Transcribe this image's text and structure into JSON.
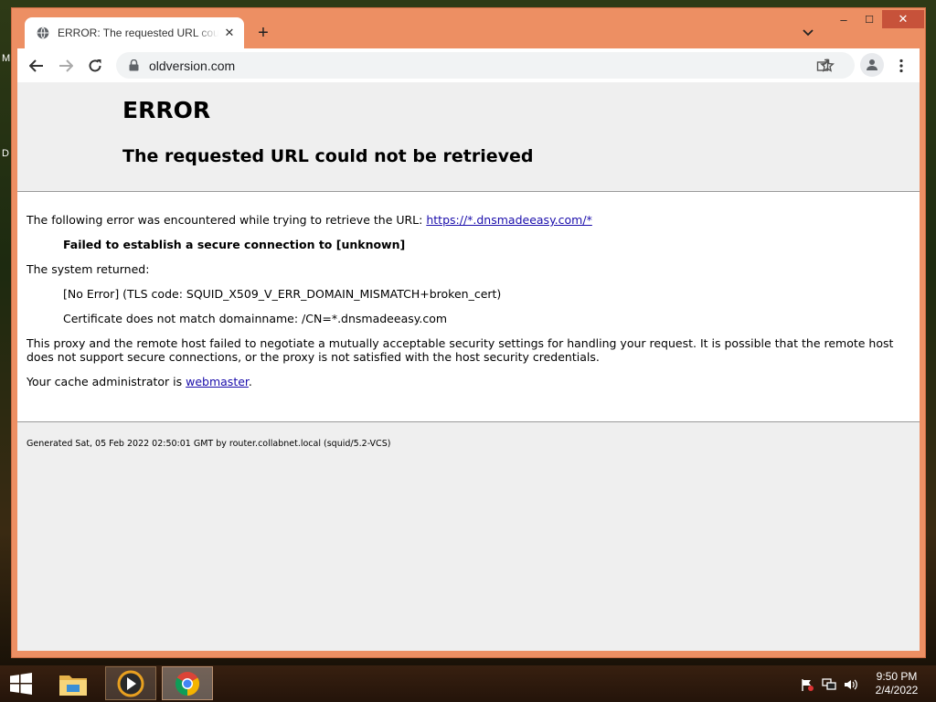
{
  "desktop": {
    "edge_letters": [
      "M",
      "D"
    ]
  },
  "browser": {
    "tab": {
      "title": "ERROR: The requested URL could not be retrieved",
      "icon": "globe-icon"
    },
    "new_tab_label": "+",
    "window_controls": {
      "minimize": "–",
      "maximize": "☐",
      "close": "✕"
    },
    "toolbar": {
      "back_icon": "arrow-left-icon",
      "forward_icon": "arrow-right-icon",
      "reload_icon": "reload-icon",
      "url": "oldversion.com"
    }
  },
  "page": {
    "h1": "ERROR",
    "h2": "The requested URL could not be retrieved",
    "intro_prefix": "The following error was encountered while trying to retrieve the URL: ",
    "intro_link": "https://*.dnsmadeeasy.com/*",
    "error_detail": "Failed to establish a secure connection to [unknown]",
    "system_returned": "The system returned:",
    "tls_code": "[No Error] (TLS code: SQUID_X509_V_ERR_DOMAIN_MISMATCH+broken_cert)",
    "cert_msg": "Certificate does not match domainname: /CN=*.dnsmadeeasy.com",
    "explanation": "This proxy and the remote host failed to negotiate a mutually acceptable security settings for handling your request. It is possible that the remote host does not support secure connections, or the proxy is not satisfied with the host security credentials.",
    "admin_prefix": "Your cache administrator is ",
    "admin_link": "webmaster",
    "admin_suffix": ".",
    "footer": "Generated Sat, 05 Feb 2022 02:50:01 GMT by router.collabnet.local (squid/5.2-VCS)"
  },
  "taskbar": {
    "apps": [
      "file-explorer-icon",
      "media-player-icon",
      "chrome-icon"
    ],
    "clock_time": "9:50 PM",
    "clock_date": "2/4/2022"
  },
  "colors": {
    "window_frame": "#ed8f63",
    "link": "#1a0dab",
    "close_button": "#c7523a"
  }
}
